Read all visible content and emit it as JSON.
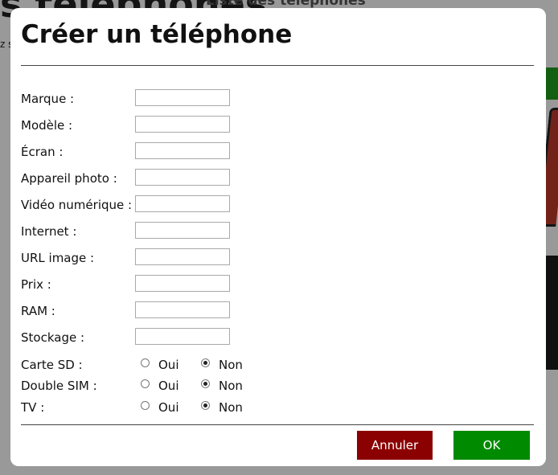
{
  "background": {
    "title_fragment": "s téléphones",
    "subtitle": "Liste des téléphones",
    "side_text": "z s"
  },
  "dialog": {
    "title": "Créer un téléphone",
    "fields": [
      {
        "label": "Marque :",
        "value": ""
      },
      {
        "label": "Modèle :",
        "value": ""
      },
      {
        "label": "Écran :",
        "value": ""
      },
      {
        "label": "Appareil photo :",
        "value": ""
      },
      {
        "label": "Vidéo numérique :",
        "value": ""
      },
      {
        "label": "Internet :",
        "value": ""
      },
      {
        "label": "URL image :",
        "value": ""
      },
      {
        "label": "Prix :",
        "value": ""
      },
      {
        "label": "RAM :",
        "value": ""
      },
      {
        "label": "Stockage :",
        "value": ""
      }
    ],
    "radio_groups": [
      {
        "label": "Carte SD :",
        "options": [
          "Oui",
          "Non"
        ],
        "selected": "Non"
      },
      {
        "label": "Double SIM :",
        "options": [
          "Oui",
          "Non"
        ],
        "selected": "Non"
      },
      {
        "label": "TV :",
        "options": [
          "Oui",
          "Non"
        ],
        "selected": "Non"
      }
    ],
    "buttons": {
      "cancel_label": "Annuler",
      "ok_label": "OK"
    }
  },
  "colors": {
    "cancel_button": "#8b0000",
    "ok_button": "#008a00",
    "overlay": "rgba(0,0,0,0.40)"
  }
}
